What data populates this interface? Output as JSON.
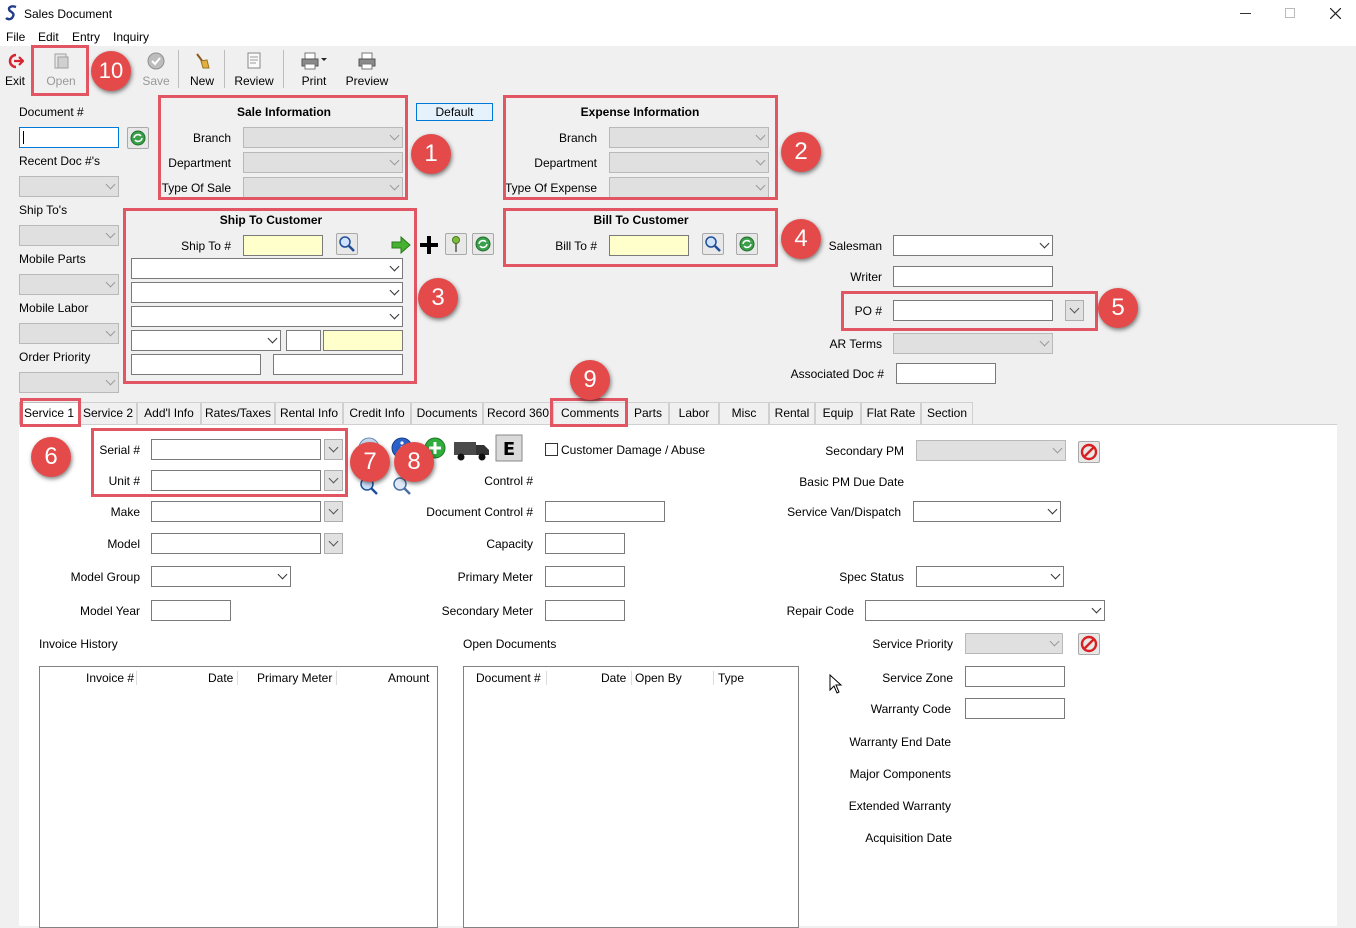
{
  "window": {
    "title": "Sales Document"
  },
  "menu": {
    "file": "File",
    "edit": "Edit",
    "entry": "Entry",
    "inquiry": "Inquiry"
  },
  "toolbar": {
    "exit": "Exit",
    "open": "Open",
    "save": "Save",
    "new": "New",
    "review": "Review",
    "print": "Print",
    "preview": "Preview"
  },
  "left": {
    "document_label": "Document #",
    "recent_docs_label": "Recent Doc #'s",
    "ship_tos_label": "Ship To's",
    "mobile_parts_label": "Mobile Parts",
    "mobile_labor_label": "Mobile Labor",
    "order_priority_label": "Order Priority"
  },
  "sale_info": {
    "title": "Sale Information",
    "branch_label": "Branch",
    "department_label": "Department",
    "type_of_sale_label": "Type Of Sale",
    "default_button": "Default"
  },
  "expense_info": {
    "title": "Expense Information",
    "branch_label": "Branch",
    "department_label": "Department",
    "type_of_expense_label": "Type Of Expense"
  },
  "ship_to": {
    "title": "Ship To Customer",
    "ship_to_label": "Ship To #"
  },
  "bill_to": {
    "title": "Bill To Customer",
    "bill_to_label": "Bill To #"
  },
  "right_header": {
    "salesman_label": "Salesman",
    "writer_label": "Writer",
    "po_label": "PO #",
    "ar_terms_label": "AR Terms",
    "associated_doc_label": "Associated Doc #"
  },
  "tabs": [
    "Service 1",
    "Service 2",
    "Add'l Info",
    "Rates/Taxes",
    "Rental Info",
    "Credit Info",
    "Documents",
    "Record 360",
    "Comments",
    "Parts",
    "Labor",
    "Misc",
    "Rental",
    "Equip",
    "Flat Rate",
    "Section"
  ],
  "service": {
    "serial_label": "Serial #",
    "unit_label": "Unit #",
    "make_label": "Make",
    "model_label": "Model",
    "model_group_label": "Model Group",
    "model_year_label": "Model Year",
    "customer_damage_label": "Customer Damage / Abuse",
    "control_label": "Control #",
    "document_control_label": "Document Control #",
    "capacity_label": "Capacity",
    "primary_meter_label": "Primary Meter",
    "secondary_meter_label": "Secondary Meter",
    "secondary_pm_label": "Secondary PM",
    "basic_pm_due_label": "Basic PM Due Date",
    "service_van_label": "Service Van/Dispatch",
    "spec_status_label": "Spec Status",
    "repair_code_label": "Repair Code",
    "service_priority_label": "Service Priority",
    "service_zone_label": "Service Zone",
    "warranty_code_label": "Warranty Code",
    "warranty_end_label": "Warranty End Date",
    "major_components_label": "Major Components",
    "extended_warranty_label": "Extended Warranty",
    "acquisition_date_label": "Acquisition Date",
    "invoice_history": {
      "title": "Invoice History",
      "columns": [
        "Invoice #",
        "Date",
        "Primary Meter",
        "Amount"
      ]
    },
    "open_documents": {
      "title": "Open Documents",
      "columns": [
        "Document #",
        "Date",
        "Open By",
        "Type"
      ]
    }
  },
  "callouts": [
    "1",
    "2",
    "3",
    "4",
    "5",
    "6",
    "7",
    "8",
    "9",
    "10"
  ],
  "colors": {
    "callout": "#e44a4a",
    "callout_box": "#e25563",
    "accent": "#0078d7",
    "required_field": "#ffffcc"
  }
}
